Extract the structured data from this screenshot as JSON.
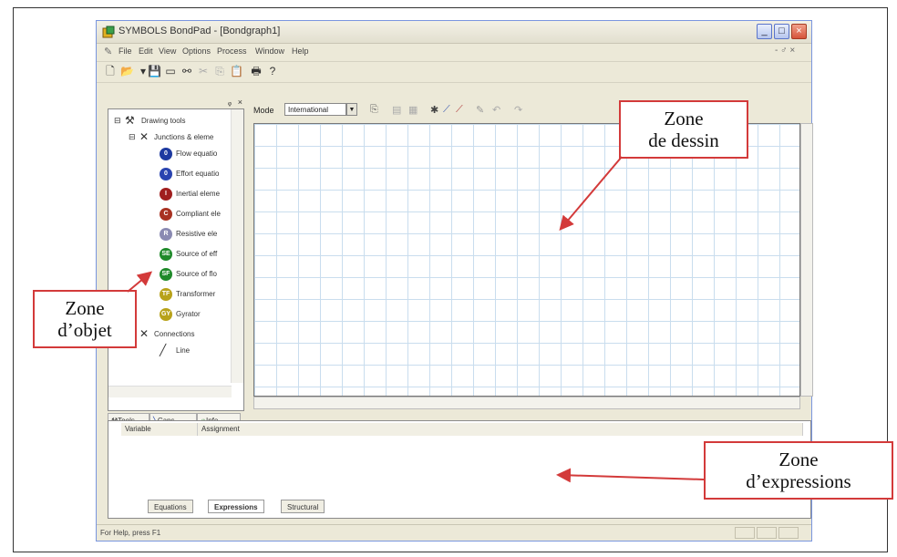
{
  "window": {
    "title": "SYMBOLS BondPad - [Bondgraph1]",
    "controls": {
      "minimize": "_",
      "maximize": "□",
      "close": "×"
    }
  },
  "menu": {
    "items": [
      "File",
      "Edit",
      "View",
      "Options",
      "Process",
      "Window",
      "Help"
    ],
    "doc_controls": "- ♂ ×"
  },
  "left_pane": {
    "header": {
      "pin": "ᵩ",
      "close": "×"
    },
    "tree": {
      "drawing_tools": "Drawing tools",
      "junctions": "Junctions & eleme",
      "connections": "Connections",
      "line": "Line"
    },
    "elements": [
      {
        "badge": "0",
        "label": "Flow equatio",
        "color": "#1e3aa0"
      },
      {
        "badge": "0",
        "label": "Effort equatio",
        "color": "#2a44b0"
      },
      {
        "badge": "I",
        "label": "Inertial eleme",
        "color": "#a01e1e"
      },
      {
        "badge": "C",
        "label": "Compliant ele",
        "color": "#a83222"
      },
      {
        "badge": "R",
        "label": "Resistive ele",
        "color": "#8a8ab2"
      },
      {
        "badge": "SE",
        "label": "Source of eff",
        "color": "#1f8a2a"
      },
      {
        "badge": "SF",
        "label": "Source of flo",
        "color": "#1f8a2a"
      },
      {
        "badge": "TF",
        "label": "Transformer",
        "color": "#b8a21a"
      },
      {
        "badge": "GY",
        "label": "Gyrator",
        "color": "#b8a21a"
      }
    ],
    "tabs": [
      "Tools",
      "Caps",
      "Info"
    ]
  },
  "drawing": {
    "mode_label": "Mode",
    "mode_value": "International"
  },
  "expressions": {
    "columns": [
      "Variable",
      "Assignment"
    ],
    "tabs": [
      "Equations",
      "Expressions",
      "Structural"
    ],
    "active_tab": "Expressions"
  },
  "status": {
    "text": "For Help, press F1"
  },
  "annotations": {
    "zone_dessin": [
      "Zone",
      "de dessin"
    ],
    "zone_objet": [
      "Zone",
      "d’objet"
    ],
    "zone_expressions": [
      "Zone",
      "d’expressions"
    ]
  },
  "colors": {
    "callout_border": "#d33a3a",
    "grid": "#c9ddee"
  }
}
